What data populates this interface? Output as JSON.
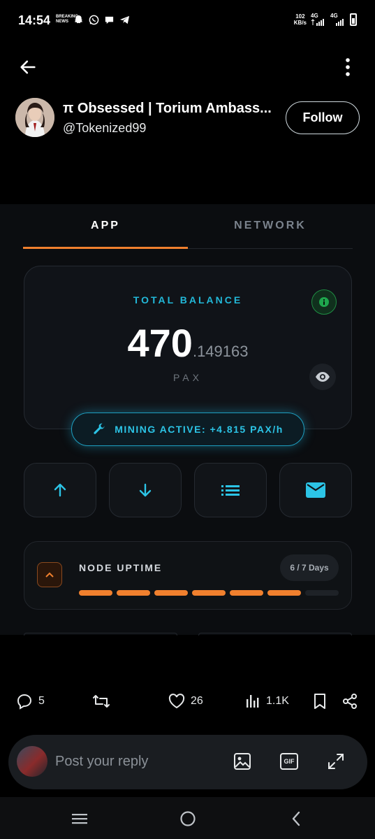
{
  "status_bar": {
    "time": "14:54",
    "news_badge": "BREAKING NEWS",
    "net_speed_value": "102",
    "net_speed_unit": "KB/s",
    "signal1_label": "4G",
    "signal2_label": "4G",
    "icons": [
      "snapchat-icon",
      "whatsapp-icon",
      "chat-icon",
      "telegram-icon",
      "signal-icon",
      "battery-icon"
    ]
  },
  "header": {
    "back_icon": "arrow-left-icon",
    "more_icon": "more-vertical-icon"
  },
  "profile": {
    "display_name": "π Obsessed | Torium Ambass...",
    "handle": "@Tokenized99",
    "follow_label": "Follow"
  },
  "app": {
    "tabs": [
      {
        "label": "APP",
        "active": true
      },
      {
        "label": "NETWORK",
        "active": false
      }
    ],
    "accent_color": "#f0802e",
    "cyan_color": "#2cc4e6",
    "balance": {
      "label": "TOTAL BALANCE",
      "integer": "470",
      "decimal": ".149163",
      "unit": "PAX"
    },
    "mining": {
      "label": "MINING ACTIVE: +4.815 PAX/h",
      "icon": "wrench-icon"
    },
    "actions": [
      {
        "icon": "arrow-up-icon"
      },
      {
        "icon": "arrow-down-icon"
      },
      {
        "icon": "list-icon"
      },
      {
        "icon": "mail-icon"
      }
    ],
    "uptime": {
      "label": "NODE UPTIME",
      "badge": "6 / 7 Days",
      "days_active": 6,
      "days_total": 7
    }
  },
  "engagement": {
    "replies": "5",
    "reposts": "",
    "likes": "26",
    "views": "1.1K"
  },
  "reply": {
    "placeholder": "Post your reply",
    "gif_label": "GIF"
  },
  "nav": {
    "icons": [
      "recents-icon",
      "home-icon",
      "back-icon"
    ]
  }
}
